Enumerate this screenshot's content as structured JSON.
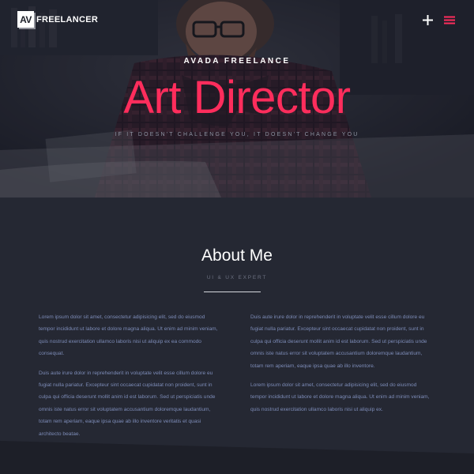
{
  "header": {
    "logo_mark": "AV",
    "logo_text": "FREELANCER",
    "plus_icon": "plus-icon",
    "menu_icon": "hamburger-menu-icon",
    "accent_color": "#ff2d5c"
  },
  "hero": {
    "kicker": "AVADA FREELANCE",
    "title": "Art Director",
    "tagline": "IF IT DOESN'T CHALLENGE YOU, IT DOESN'T CHANGE YOU"
  },
  "about": {
    "title": "About Me",
    "subtitle": "UI & UX EXPERT",
    "left": {
      "p1": "Lorem ipsum dolor sit amet, consectetur adipisicing elit, sed do eiusmod tempor incididunt ut labore et dolore magna aliqua. Ut enim ad minim veniam, quis nostrud exercitation ullamco laboris nisi ut aliquip ex ea commodo consequat.",
      "p2": "Duis aute irure dolor in reprehenderit in voluptate velit esse cillum dolore eu fugiat nulla pariatur. Excepteur sint occaecat cupidatat non proident, sunt in culpa qui officia deserunt mollit anim id est laborum. Sed ut perspiciatis unde omnis iste natus error sit voluptatem accusantium doloremque laudantium, totam rem aperiam, eaque ipsa quae ab illo inventore veritatis et quasi architecto beatae."
    },
    "right": {
      "p1": "Duis aute irure dolor in reprehenderit in voluptate velit esse cillum dolore eu fugiat nulla pariatur. Excepteur sint occaecat cupidatat non proident, sunt in culpa qui officia deserunt mollit anim id est laborum. Sed ut perspiciatis unde omnis iste natus error sit voluptatem accusantium doloremque laudantium, totam rem aperiam, eaque ipsa quae ab illo inventore.",
      "p2": "Lorem ipsum dolor sit amet, consectetur adipisicing elit, sed do eiusmod tempor incididunt ut labore et dolore magna aliqua. Ut enim ad minim veniam, quis nostrud exercitation ullamco laboris nisi ut aliquip ex."
    }
  }
}
